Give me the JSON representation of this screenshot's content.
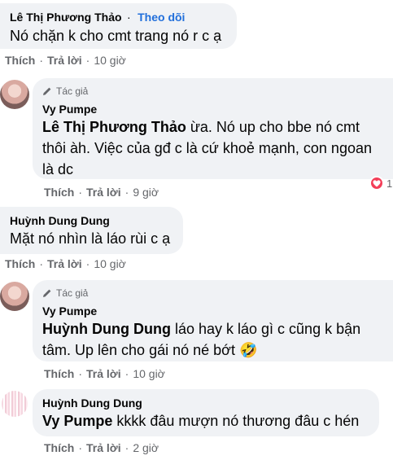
{
  "comments": [
    {
      "name": "Lê Thị Phương Thảo",
      "separator": "·",
      "follow": "Theo dõi",
      "text": "Nó chặn k cho cmt trang nó r c ạ",
      "like": "Thích",
      "reply": "Trả lời",
      "time": "10 giờ"
    },
    {
      "author_badge": "Tác giả",
      "name": "Vy Pumpe",
      "tag": "Lê Thị Phương Thảo",
      "text": " ừa. Nó up cho bbe nó cmt thôi àh. Việc của gđ c là cứ khoẻ mạnh, con ngoan là dc",
      "like": "Thích",
      "reply": "Trả lời",
      "time": "9 giờ",
      "reaction": "heart",
      "reaction_count": "1"
    },
    {
      "name": "Huỳnh Dung Dung",
      "text": "Mặt nó nhìn là láo rùi c ạ",
      "like": "Thích",
      "reply": "Trả lời",
      "time": "10 giờ"
    },
    {
      "author_badge": "Tác giả",
      "name": "Vy Pumpe",
      "tag": "Huỳnh Dung Dung",
      "text": " láo hay k láo gì c cũng k bận tâm. Up lên cho gái nó né bớt 🤣",
      "like": "Thích",
      "reply": "Trả lời",
      "time": "10 giờ"
    },
    {
      "name": "Huỳnh Dung Dung",
      "tag": "Vy Pumpe",
      "text": " kkkk đâu mượn nó thương đâu c hén",
      "like": "Thích",
      "reply": "Trả lời",
      "time": "2 giờ"
    }
  ]
}
